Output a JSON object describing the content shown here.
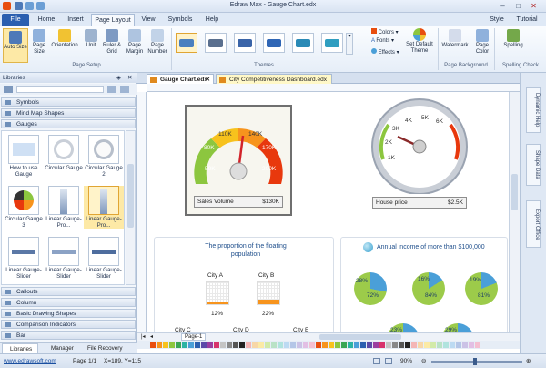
{
  "window": {
    "title": "Edraw Max - Gauge Chart.edx"
  },
  "menu_tabs": [
    "File",
    "Home",
    "Insert",
    "Page Layout",
    "View",
    "Symbols",
    "Help"
  ],
  "menu_right": {
    "style": "Style",
    "tutorial": "Tutorial"
  },
  "ribbon": {
    "page_setup": {
      "auto_size": "Auto Size",
      "page_size": "Page Size",
      "orientation": "Orientation",
      "unit": "Unit",
      "ruler_grid": "Ruler & Grid",
      "page_margin": "Page Margin",
      "page_number": "Page Number",
      "group": "Page Setup"
    },
    "themes": {
      "group": "Themes",
      "colors": "Colors",
      "fonts": "Fonts",
      "effects": "Effects",
      "get_default": "Set Default Theme"
    },
    "page_background": {
      "watermark": "Watermark",
      "page_color": "Page Color",
      "group": "Page Background"
    },
    "spelling": {
      "spelling": "Spelling",
      "group": "Spelling Check"
    }
  },
  "libraries": {
    "title": "Libraries",
    "categories_top": [
      "Symbols",
      "Mind Map Shapes",
      "Gauges"
    ],
    "shapes": [
      {
        "label": "How to use Gauge"
      },
      {
        "label": "Circular Gauge"
      },
      {
        "label": "Circular Gauge 2"
      },
      {
        "label": "Circular Gauge 3"
      },
      {
        "label": "Linear Gauge-Pro..."
      },
      {
        "label": "Linear Gauge-Pro..."
      },
      {
        "label": "Linear Gauge-Slider"
      },
      {
        "label": "Linear Gauge-Slider"
      },
      {
        "label": "Linear Gauge-Slider"
      }
    ],
    "categories_bottom": [
      "Callouts",
      "Column",
      "Basic Drawing Shapes",
      "Comparison Indicators",
      "Bar"
    ],
    "bottom_tabs": [
      "Libraries",
      "Manager",
      "File Recovery"
    ]
  },
  "doc_tabs": [
    "Gauge Chart.edx",
    "City Competitiveness Dashboard.edx"
  ],
  "page_tab": "Page-1",
  "gauge1": {
    "labels": [
      "50K",
      "80K",
      "110K",
      "140K",
      "170K",
      "200K"
    ],
    "readout_label": "Sales Volume",
    "readout_value": "$130K"
  },
  "gauge2": {
    "labels": [
      "1K",
      "2K",
      "3K",
      "4K",
      "5K",
      "6K"
    ],
    "readout_label": "House price",
    "readout_value": "$2.5K"
  },
  "panel_left": {
    "title": "The proportion of the floating population",
    "cities": [
      {
        "name": "City A",
        "pct": "12%"
      },
      {
        "name": "City B",
        "pct": "22%"
      },
      {
        "name": "City C"
      },
      {
        "name": "City D"
      },
      {
        "name": "City E"
      }
    ]
  },
  "panel_right": {
    "title": "Annual income of more than $100,000",
    "donuts": [
      {
        "small": "28%",
        "big": "72%",
        "small_pct": 28
      },
      {
        "small": "16%",
        "big": "84%",
        "small_pct": 16
      },
      {
        "small": "19%",
        "big": "81%",
        "small_pct": 19
      },
      {
        "small": "23%",
        "big": "",
        "small_pct": 23
      },
      {
        "small": "29%",
        "big": "",
        "small_pct": 29
      }
    ]
  },
  "right_panels": [
    "Dynamic Help",
    "Shape Data",
    "Export Office"
  ],
  "status": {
    "link": "www.edrawsoft.com",
    "page": "Page 1/1",
    "coords": "X=189, Y=115",
    "zoom": "90%"
  },
  "colors": {
    "accent": "#2b5fb0",
    "gauge_green": "#8cc63f",
    "gauge_orange": "#f7941d",
    "gauge_red": "#e8380d",
    "donut_blue": "#4a9fd8",
    "donut_green": "#9ccb4a"
  }
}
